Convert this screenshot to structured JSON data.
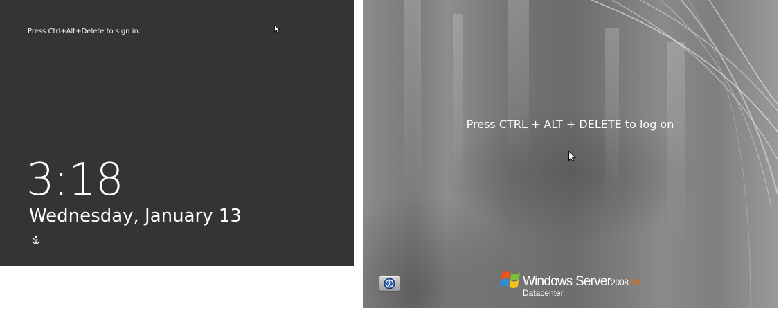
{
  "left_screen": {
    "sign_in_hint": "Press Ctrl+Alt+Delete to sign in.",
    "time": "3:18",
    "date": "Wednesday, January 13",
    "ease_of_access_icon": "ease-of-access-icon",
    "background_color": "#343434"
  },
  "right_screen": {
    "logon_prompt": "Press CTRL + ALT + DELETE to log on",
    "ease_of_access_icon": "ease-of-access-icon",
    "brand": {
      "logo_icon": "windows-flag-icon",
      "name": "Windows Server",
      "version": "2008",
      "release": "R2",
      "edition": "Datacenter",
      "release_color": "#e46c0a"
    }
  }
}
